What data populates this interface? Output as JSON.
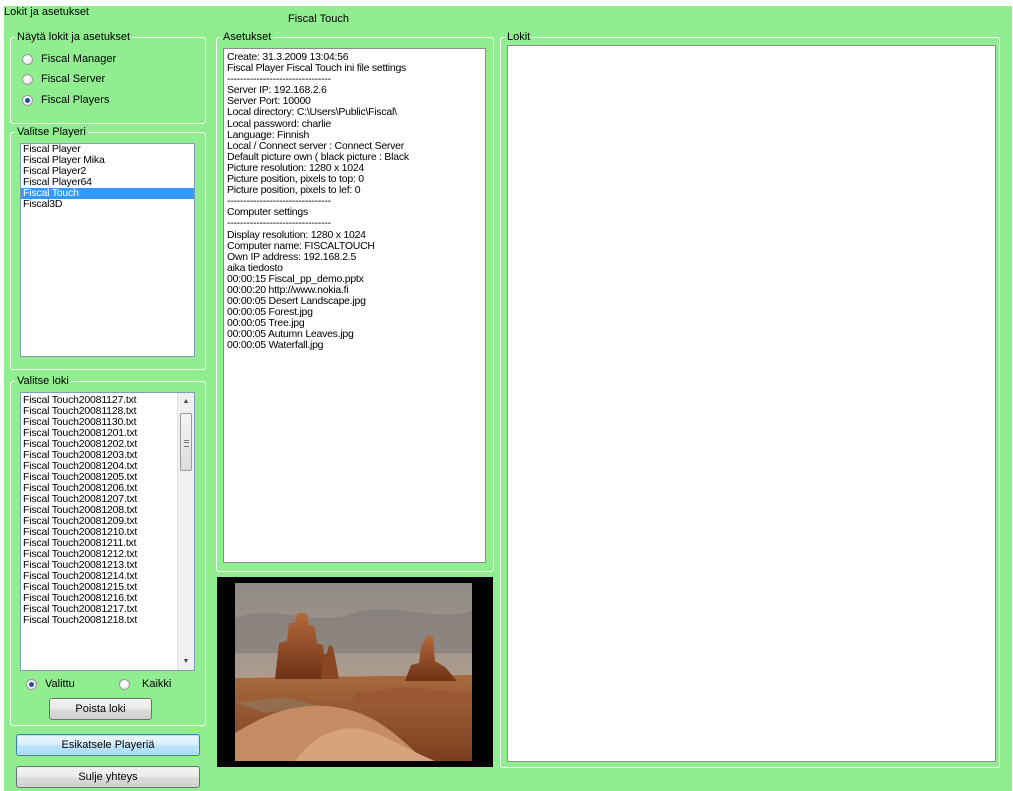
{
  "window": {
    "app_label": "Lokit ja asetukset",
    "player_title": "Fiscal Touch"
  },
  "show_group": {
    "legend": "Näytä lokit ja asetukset",
    "options": [
      {
        "label": "Fiscal Manager",
        "selected": false
      },
      {
        "label": "Fiscal Server",
        "selected": false
      },
      {
        "label": "Fiscal Players",
        "selected": true
      }
    ]
  },
  "player_group": {
    "legend": "Valitse Playeri",
    "items": [
      "Fiscal Player",
      "Fiscal Player Mika",
      "Fiscal Player2",
      "Fiscal Player64",
      "Fiscal Touch",
      "Fiscal3D"
    ],
    "selected_index": 4
  },
  "log_group": {
    "legend": "Valitse loki",
    "items": [
      "Fiscal Touch20081127.txt",
      "Fiscal Touch20081128.txt",
      "Fiscal Touch20081130.txt",
      "Fiscal Touch20081201.txt",
      "Fiscal Touch20081202.txt",
      "Fiscal Touch20081203.txt",
      "Fiscal Touch20081204.txt",
      "Fiscal Touch20081205.txt",
      "Fiscal Touch20081206.txt",
      "Fiscal Touch20081207.txt",
      "Fiscal Touch20081208.txt",
      "Fiscal Touch20081209.txt",
      "Fiscal Touch20081210.txt",
      "Fiscal Touch20081211.txt",
      "Fiscal Touch20081212.txt",
      "Fiscal Touch20081213.txt",
      "Fiscal Touch20081214.txt",
      "Fiscal Touch20081215.txt",
      "Fiscal Touch20081216.txt",
      "Fiscal Touch20081217.txt",
      "Fiscal Touch20081218.txt"
    ],
    "filter_selected": "Valittu",
    "filter_all": "Kaikki",
    "delete_button": "Poista loki"
  },
  "buttons": {
    "preview": "Esikatsele Playeriä",
    "close": "Sulje yhteys"
  },
  "settings_group": {
    "legend": "Asetukset",
    "lines": [
      "Create: 31.3.2009 13:04:56",
      "Fiscal Player Fiscal Touch ini file settings",
      "--------------------------------",
      "Server IP: 192.168.2.6",
      "Server Port: 10000",
      "Local directory: C:\\Users\\Public\\Fiscal\\",
      "Local password: charlie",
      "Language: Finnish",
      "Local / Connect server : Connect Server",
      "Default picture own ( black picture : Black",
      "Picture resolution: 1280 x 1024",
      "Picture position, pixels to top: 0",
      "Picture position, pixels to lef: 0",
      "--------------------------------",
      "Computer settings",
      "--------------------------------",
      "Display resolution: 1280 x 1024",
      "Computer name: FISCALTOUCH",
      "Own IP address: 192.168.2.5",
      "aika              tiedosto",
      "00:00:15 Fiscal_pp_demo.pptx",
      "00:00:20 http://www.nokia.fi",
      "00:00:05 Desert Landscape.jpg",
      "00:00:05 Forest.jpg",
      "00:00:05 Tree.jpg",
      "00:00:05 Autumn Leaves.jpg",
      "00:00:05 Waterfall.jpg"
    ]
  },
  "logs_group": {
    "legend": "Lokit"
  },
  "colors": {
    "window_bg": "#90ee90",
    "selection": "#3399ff",
    "radio_dot": "#1f4fa0"
  },
  "icons": {
    "scroll_up": "scroll-up-icon",
    "scroll_down": "scroll-down-icon",
    "scroll_grip": "scroll-grip-icon"
  }
}
